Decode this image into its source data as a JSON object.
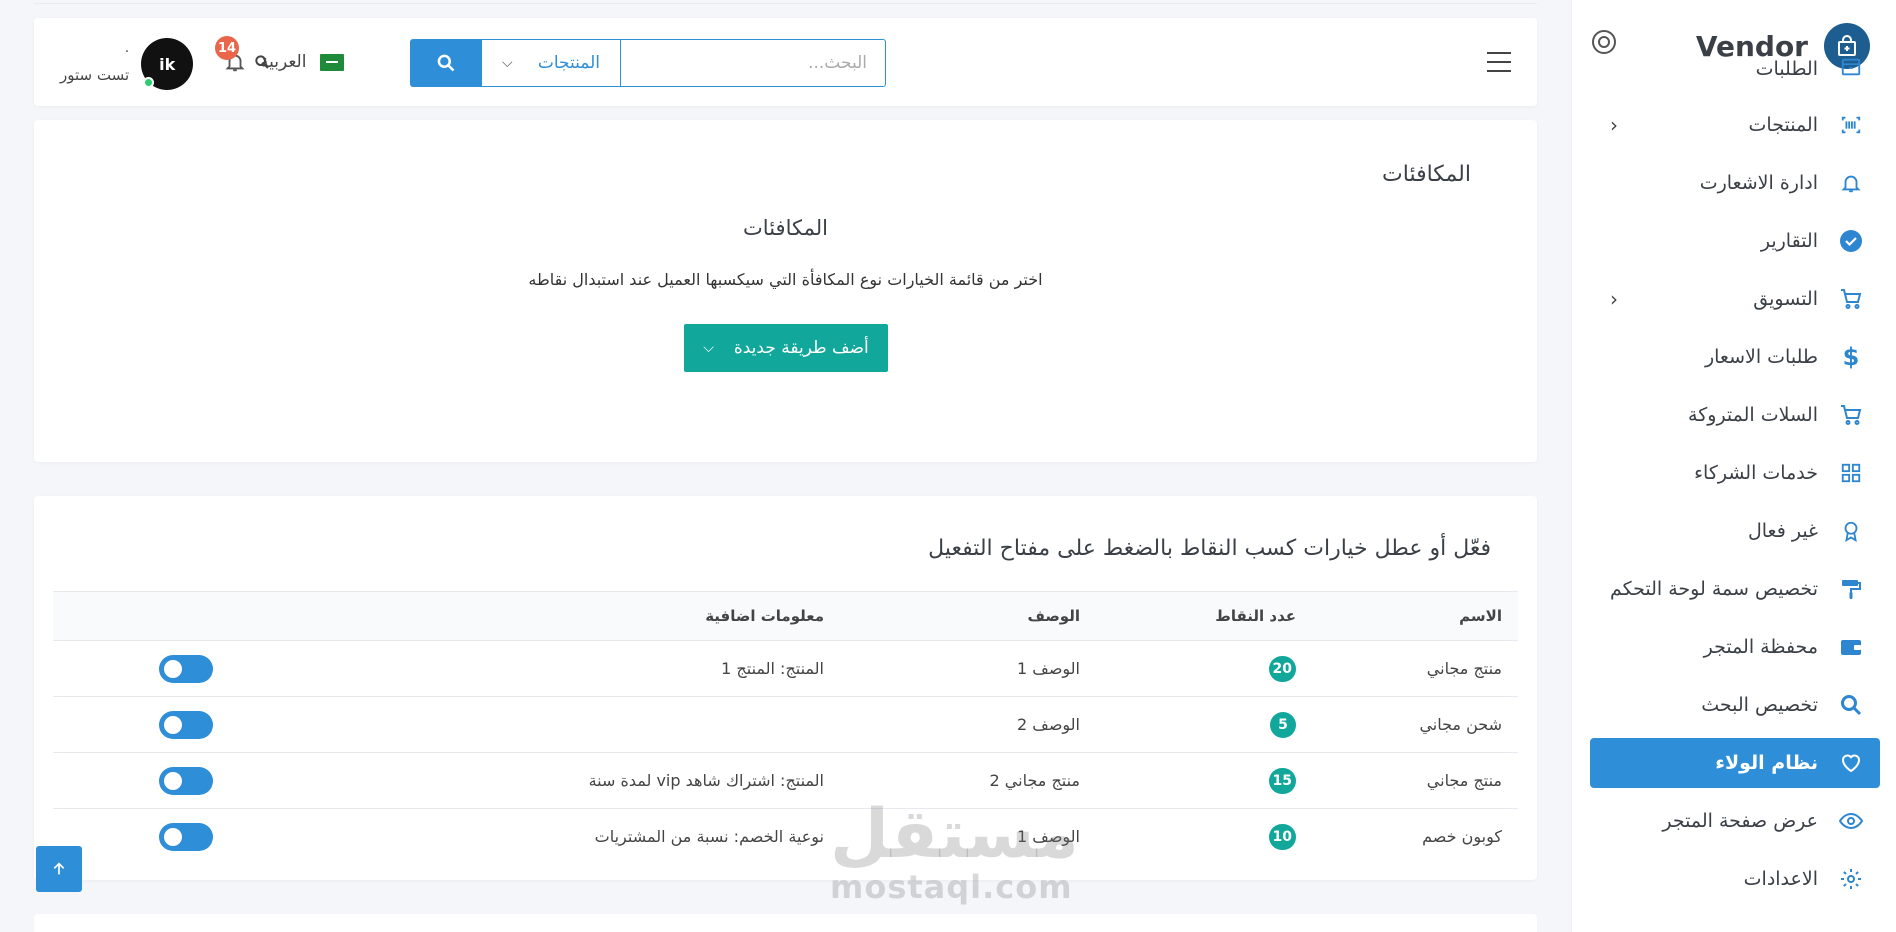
{
  "sidebar": {
    "brand": "Vendor",
    "items": [
      {
        "label": "الطلبات",
        "icon": "box-icon",
        "chevron": false
      },
      {
        "label": "المنتجات",
        "icon": "barcode-icon",
        "chevron": true
      },
      {
        "label": "ادارة الاشعارت",
        "icon": "bell-icon",
        "chevron": false
      },
      {
        "label": "التقارير",
        "icon": "check-circle-icon",
        "chevron": false
      },
      {
        "label": "التسويق",
        "icon": "cart-icon",
        "chevron": true
      },
      {
        "label": "طلبات الاسعار",
        "icon": "dollar-icon",
        "chevron": false
      },
      {
        "label": "السلات المتروكة",
        "icon": "cart-icon",
        "chevron": false
      },
      {
        "label": "خدمات الشركاء",
        "icon": "grid-icon",
        "chevron": false
      },
      {
        "label": "غير فعال",
        "icon": "award-icon",
        "chevron": false
      },
      {
        "label": "تخصيص سمة لوحة التحكم",
        "icon": "paint-roller-icon",
        "chevron": false
      },
      {
        "label": "محفظة المتجر",
        "icon": "wallet-icon",
        "chevron": false
      },
      {
        "label": "تخصيص البحث",
        "icon": "search-icon",
        "chevron": false
      },
      {
        "label": "نظام الولاء",
        "icon": "heart-icon",
        "chevron": false,
        "active": true
      },
      {
        "label": "عرض صفحة المتجر",
        "icon": "eye-icon",
        "chevron": false
      },
      {
        "label": "الاعدادات",
        "icon": "gear-icon",
        "chevron": false
      }
    ]
  },
  "header": {
    "search_placeholder": "البحث...",
    "search_category": "المنتجات",
    "language": "العربية",
    "notifications_count": "14",
    "user_name": "تست ستور",
    "user_sub": "·",
    "avatar_text": "ik"
  },
  "rewards": {
    "card_title": "المكافئات",
    "inner_title": "المكافئات",
    "description": "اختر من قائمة الخيارات نوع المكافأة التي سيكسبها العميل عند استبدال نقاطه",
    "add_button": "أضف طريقة جديدة"
  },
  "points": {
    "title": "فعّل أو عطل خيارات كسب النقاط بالضغط على مفتاح التفعيل",
    "columns": [
      "الاسم",
      "عدد النقاط",
      "الوصف",
      "معلومات اضافية"
    ],
    "rows": [
      {
        "name": "منتج مجاني",
        "points": "20",
        "desc": "الوصف 1",
        "info": "المنتج: المنتج 1",
        "enabled": true
      },
      {
        "name": "شحن مجاني",
        "points": "5",
        "desc": "الوصف 2",
        "info": "",
        "enabled": true
      },
      {
        "name": "منتج مجاني",
        "points": "15",
        "desc": "منتج مجاني 2",
        "info": "المنتج: اشتراك شاهد vip لمدة سنة",
        "enabled": true
      },
      {
        "name": "كوبون خصم",
        "points": "10",
        "desc": "الوصف 1",
        "info": "نوعية الخصم: نسبة من المشتريات",
        "enabled": true
      }
    ]
  },
  "watermark": {
    "arabic": "مستقل",
    "latin": "mostaql.com"
  },
  "colors": {
    "primary": "#2f8ed8",
    "teal": "#12a79b",
    "badge": "#e9664b"
  }
}
